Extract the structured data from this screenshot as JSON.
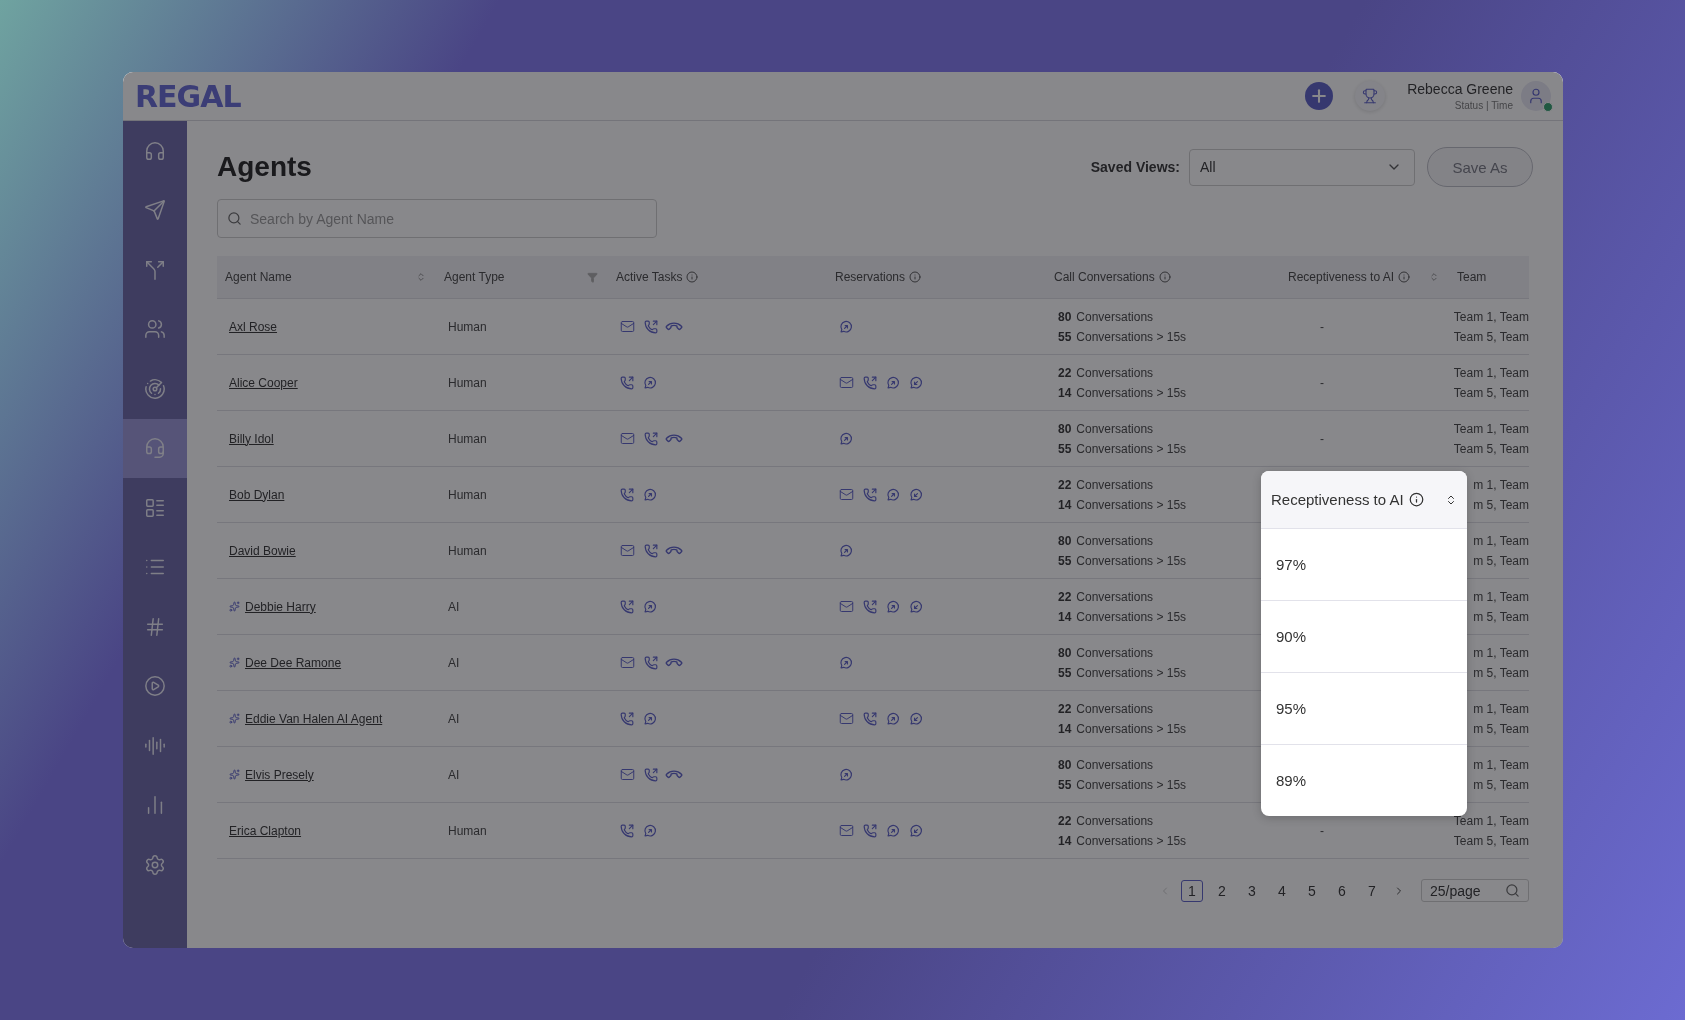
{
  "header": {
    "logo": "REGAL",
    "user_name": "Rebecca Greene",
    "user_status": "Status | Time",
    "user_online": true
  },
  "sidebar": {
    "items": [
      {
        "kind": "headphones",
        "selected": false
      },
      {
        "kind": "send",
        "selected": false
      },
      {
        "kind": "split",
        "selected": false
      },
      {
        "kind": "users",
        "selected": false
      },
      {
        "kind": "radar",
        "selected": false
      },
      {
        "kind": "headset",
        "selected": true
      },
      {
        "kind": "cards",
        "selected": false
      },
      {
        "kind": "list",
        "selected": false
      },
      {
        "kind": "hash",
        "selected": false
      },
      {
        "kind": "play",
        "selected": false
      },
      {
        "kind": "audio",
        "selected": false
      },
      {
        "kind": "chart",
        "selected": false
      },
      {
        "kind": "settings",
        "selected": false
      }
    ]
  },
  "page": {
    "title": "Agents",
    "saved_views_label": "Saved Views:",
    "saved_view": "All",
    "save_as": "Save As",
    "save_as_disabled": true,
    "search_placeholder": "Search by Agent Name"
  },
  "table": {
    "columns": [
      {
        "label": "Agent Name",
        "info": false,
        "sortable": true,
        "filterable": false
      },
      {
        "label": "Agent Type",
        "info": false,
        "sortable": false,
        "filterable": true
      },
      {
        "label": "Active Tasks",
        "info": true,
        "sortable": false,
        "filterable": false
      },
      {
        "label": "Reservations",
        "info": true,
        "sortable": false,
        "filterable": false
      },
      {
        "label": "Call Conversations",
        "info": true,
        "sortable": false,
        "filterable": false
      },
      {
        "label": "Receptiveness to AI",
        "info": true,
        "sortable": true,
        "filterable": false
      },
      {
        "label": "Team",
        "info": false,
        "sortable": false,
        "filterable": false
      }
    ],
    "rows": [
      {
        "name": "Axl Rose",
        "ai": false,
        "type": "Human",
        "active_tasks": [
          {
            "kind": "email"
          },
          {
            "kind": "call"
          },
          {
            "kind": "hangup"
          }
        ],
        "reservations": [
          {
            "kind": "chat"
          }
        ],
        "conversations": "80",
        "conversations_label": "Conversations",
        "long_conversations": "55",
        "long_label": "Conversations > 15s",
        "receptiveness": "-",
        "team_1": "Team 1, Team",
        "team_2": "Team 5, Team"
      },
      {
        "name": "Alice Cooper",
        "ai": false,
        "type": "Human",
        "active_tasks": [
          {
            "kind": "call"
          },
          {
            "kind": "chat"
          }
        ],
        "reservations": [
          {
            "kind": "email"
          },
          {
            "kind": "call"
          },
          {
            "kind": "chat"
          },
          {
            "kind": "chat-in"
          }
        ],
        "conversations": "22",
        "conversations_label": "Conversations",
        "long_conversations": "14",
        "long_label": "Conversations > 15s",
        "receptiveness": "-",
        "team_1": "Team 1, Team",
        "team_2": "Team 5, Team"
      },
      {
        "name": "Billy Idol",
        "ai": false,
        "type": "Human",
        "active_tasks": [
          {
            "kind": "email"
          },
          {
            "kind": "call"
          },
          {
            "kind": "hangup"
          }
        ],
        "reservations": [
          {
            "kind": "chat"
          }
        ],
        "conversations": "80",
        "conversations_label": "Conversations",
        "long_conversations": "55",
        "long_label": "Conversations > 15s",
        "receptiveness": "-",
        "team_1": "Team 1, Team",
        "team_2": "Team 5, Team"
      },
      {
        "name": "Bob Dylan",
        "ai": false,
        "type": "Human",
        "active_tasks": [
          {
            "kind": "call"
          },
          {
            "kind": "chat"
          }
        ],
        "reservations": [
          {
            "kind": "email"
          },
          {
            "kind": "call"
          },
          {
            "kind": "chat"
          },
          {
            "kind": "chat-in"
          }
        ],
        "conversations": "22",
        "conversations_label": "Conversations",
        "long_conversations": "14",
        "long_label": "Conversations > 15s",
        "team_1": "m 1, Team",
        "team_2": "m 5, Team"
      },
      {
        "name": "David Bowie",
        "ai": false,
        "type": "Human",
        "active_tasks": [
          {
            "kind": "email"
          },
          {
            "kind": "call"
          },
          {
            "kind": "hangup"
          }
        ],
        "reservations": [
          {
            "kind": "chat"
          }
        ],
        "conversations": "80",
        "conversations_label": "Conversations",
        "long_conversations": "55",
        "long_label": "Conversations > 15s",
        "team_1": "m 1, Team",
        "team_2": "m 5, Team"
      },
      {
        "name": "Debbie Harry",
        "ai": true,
        "type": "AI",
        "active_tasks": [
          {
            "kind": "call"
          },
          {
            "kind": "chat"
          }
        ],
        "reservations": [
          {
            "kind": "email"
          },
          {
            "kind": "call"
          },
          {
            "kind": "chat"
          },
          {
            "kind": "chat-in"
          }
        ],
        "conversations": "22",
        "conversations_label": "Conversations",
        "long_conversations": "14",
        "long_label": "Conversations > 15s",
        "team_1": "m 1, Team",
        "team_2": "m 5, Team"
      },
      {
        "name": "Dee Dee Ramone",
        "ai": true,
        "type": "AI",
        "active_tasks": [
          {
            "kind": "email"
          },
          {
            "kind": "call"
          },
          {
            "kind": "hangup"
          }
        ],
        "reservations": [
          {
            "kind": "chat"
          }
        ],
        "conversations": "80",
        "conversations_label": "Conversations",
        "long_conversations": "55",
        "long_label": "Conversations > 15s",
        "team_1": "m 1, Team",
        "team_2": "m 5, Team"
      },
      {
        "name": "Eddie Van Halen AI Agent",
        "ai": true,
        "type": "AI",
        "active_tasks": [
          {
            "kind": "call"
          },
          {
            "kind": "chat"
          }
        ],
        "reservations": [
          {
            "kind": "email"
          },
          {
            "kind": "call"
          },
          {
            "kind": "chat"
          },
          {
            "kind": "chat-in"
          }
        ],
        "conversations": "22",
        "conversations_label": "Conversations",
        "long_conversations": "14",
        "long_label": "Conversations > 15s",
        "team_1": "m 1, Team",
        "team_2": "m 5, Team"
      },
      {
        "name": "Elvis Presely",
        "ai": true,
        "type": "AI",
        "active_tasks": [
          {
            "kind": "email"
          },
          {
            "kind": "call"
          },
          {
            "kind": "hangup"
          }
        ],
        "reservations": [
          {
            "kind": "chat"
          }
        ],
        "conversations": "80",
        "conversations_label": "Conversations",
        "long_conversations": "55",
        "long_label": "Conversations > 15s",
        "team_1": "m 1, Team",
        "team_2": "m 5, Team"
      },
      {
        "name": "Erica Clapton",
        "ai": false,
        "type": "Human",
        "active_tasks": [
          {
            "kind": "call"
          },
          {
            "kind": "chat"
          }
        ],
        "reservations": [
          {
            "kind": "email"
          },
          {
            "kind": "call"
          },
          {
            "kind": "chat"
          },
          {
            "kind": "chat-in"
          }
        ],
        "conversations": "22",
        "conversations_label": "Conversations",
        "long_conversations": "14",
        "long_label": "Conversations > 15s",
        "receptiveness": "-",
        "team_1": "Team 1, Team",
        "team_2": "Team 5, Team"
      }
    ]
  },
  "popup": {
    "title": "Receptiveness to AI",
    "values": [
      "97%",
      "90%",
      "95%",
      "89%"
    ]
  },
  "pagination": {
    "prev_disabled": true,
    "pages": [
      {
        "label": "1",
        "selected": true
      },
      {
        "label": "2",
        "selected": false
      },
      {
        "label": "3",
        "selected": false
      },
      {
        "label": "4",
        "selected": false
      },
      {
        "label": "5",
        "selected": false
      },
      {
        "label": "6",
        "selected": false
      },
      {
        "label": "7",
        "selected": false
      }
    ],
    "page_size": "25/page"
  }
}
